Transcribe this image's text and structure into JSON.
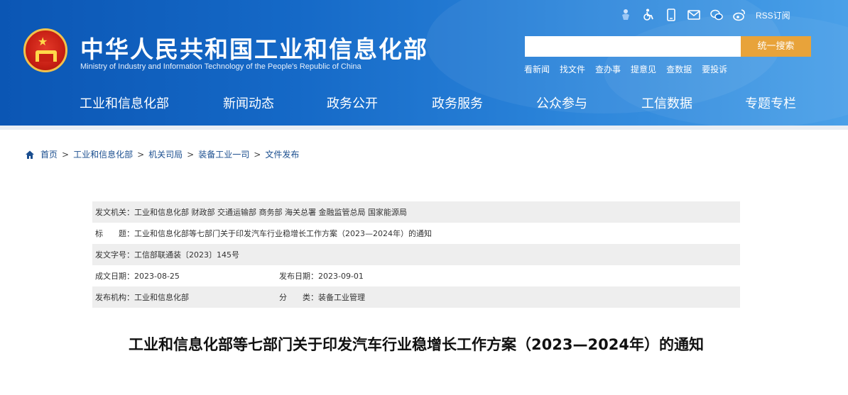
{
  "header": {
    "title_cn": "中华人民共和国工业和信息化部",
    "title_en": "Ministry of Industry and Information Technology of the People's Republic of China",
    "icons": [
      "accessibility-care-icon",
      "wheelchair-icon",
      "mobile-icon",
      "mail-icon",
      "wechat-icon",
      "weibo-icon"
    ],
    "rss_label": "RSS订阅",
    "search": {
      "placeholder": "",
      "value": "",
      "button_label": "统一搜索"
    },
    "quick_links": [
      "看新闻",
      "找文件",
      "查办事",
      "提意见",
      "查数据",
      "要投诉"
    ],
    "colors": {
      "banner": "#1569c7",
      "search_button": "#e8a33a"
    }
  },
  "nav": {
    "items": [
      "工业和信息化部",
      "新闻动态",
      "政务公开",
      "政务服务",
      "公众参与",
      "工信数据",
      "专题专栏"
    ]
  },
  "breadcrumb": {
    "items": [
      "首页",
      "工业和信息化部",
      "机关司局",
      "装备工业一司",
      "文件发布"
    ],
    "separator": ">"
  },
  "info": {
    "issuer": "发文机关：工业和信息化部 财政部 交通运输部 商务部 海关总署 金融监管总局 国家能源局",
    "title": "标　　题：工业和信息化部等七部门关于印发汽车行业稳增长工作方案（2023—2024年）的通知",
    "doc_no": "发文字号：工信部联通装〔2023〕145号",
    "created": "成文日期：2023-08-25",
    "published": "发布日期：2023-09-01",
    "publisher": "发布机构：工业和信息化部",
    "category": "分　　类：装备工业管理"
  },
  "headline": "工业和信息化部等七部门关于印发汽车行业稳增长工作方案（2023—2024年）的通知"
}
